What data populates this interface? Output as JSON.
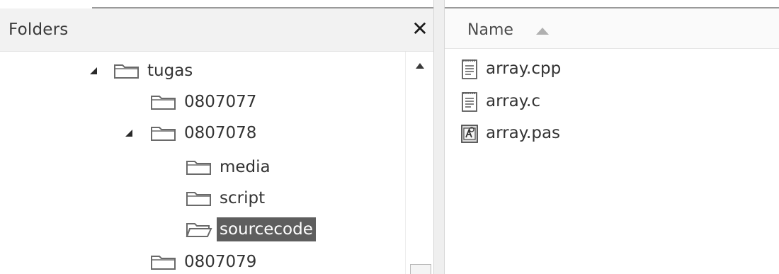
{
  "folders_pane": {
    "title": "Folders",
    "close_label": "✕",
    "tree": [
      {
        "label": "tugas",
        "expanded": true,
        "level": 0
      },
      {
        "label": "0807077",
        "expanded": false,
        "level": 1
      },
      {
        "label": "0807078",
        "expanded": true,
        "level": 1
      },
      {
        "label": "media",
        "expanded": false,
        "level": 2
      },
      {
        "label": "script",
        "expanded": false,
        "level": 2
      },
      {
        "label": "sourcecode",
        "expanded": false,
        "level": 2,
        "selected": true
      },
      {
        "label": "0807079",
        "expanded": false,
        "level": 1
      }
    ]
  },
  "file_list": {
    "column_name": "Name",
    "sort": "ascending",
    "files": [
      {
        "name": "array.cpp",
        "icon": "text-file-icon"
      },
      {
        "name": "array.c",
        "icon": "text-file-icon"
      },
      {
        "name": "array.pas",
        "icon": "pascal-file-icon"
      }
    ]
  },
  "colors": {
    "selection": "#5e5e5e",
    "folder_outline": "#6a6a6a"
  }
}
